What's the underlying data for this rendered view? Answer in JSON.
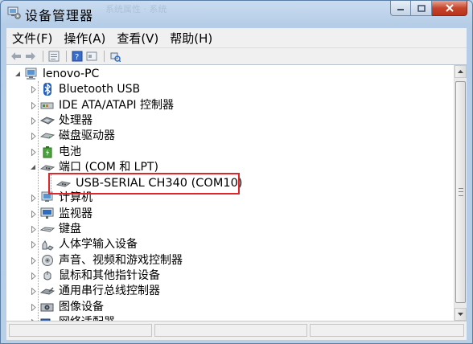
{
  "window": {
    "title": "设备管理器",
    "ghost_text": "系统属性  ·  系统"
  },
  "menu": [
    "文件(F)",
    "操作(A)",
    "查看(V)",
    "帮助(H)"
  ],
  "toolbar": [
    "back-icon",
    "forward-icon",
    "properties-icon",
    "help-icon",
    "view-icon",
    "scan-hardware-icon"
  ],
  "tree": {
    "root": "lenovo-PC",
    "categories": [
      {
        "label": "Bluetooth USB",
        "icon": "bluetooth-icon",
        "expanded": false
      },
      {
        "label": "IDE ATA/ATAPI 控制器",
        "icon": "ide-controller-icon",
        "expanded": false
      },
      {
        "label": "处理器",
        "icon": "processor-icon",
        "expanded": false
      },
      {
        "label": "磁盘驱动器",
        "icon": "disk-drive-icon",
        "expanded": false
      },
      {
        "label": "电池",
        "icon": "battery-icon",
        "expanded": false
      },
      {
        "label": "端口 (COM 和 LPT)",
        "icon": "port-icon",
        "expanded": true,
        "children": [
          {
            "label": "USB-SERIAL CH340 (COM10)",
            "icon": "serial-port-icon"
          }
        ]
      },
      {
        "label": "计算机",
        "icon": "computer-icon",
        "expanded": false
      },
      {
        "label": "监视器",
        "icon": "monitor-icon",
        "expanded": false
      },
      {
        "label": "键盘",
        "icon": "keyboard-icon",
        "expanded": false
      },
      {
        "label": "人体学输入设备",
        "icon": "hid-icon",
        "expanded": false
      },
      {
        "label": "声音、视频和游戏控制器",
        "icon": "sound-icon",
        "expanded": false
      },
      {
        "label": "鼠标和其他指针设备",
        "icon": "mouse-icon",
        "expanded": false
      },
      {
        "label": "通用串行总线控制器",
        "icon": "usb-controller-icon",
        "expanded": false
      },
      {
        "label": "图像设备",
        "icon": "imaging-icon",
        "expanded": false
      },
      {
        "label": "网络适配器",
        "icon": "network-adapter-icon",
        "expanded": false
      }
    ]
  },
  "annotation": {
    "color": "#e0262b"
  }
}
